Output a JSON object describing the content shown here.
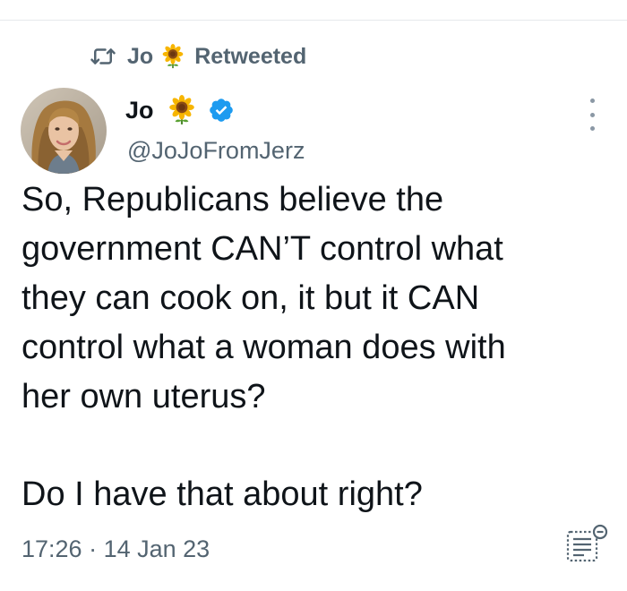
{
  "retweet_header": {
    "icon": "retweet-icon",
    "name": "Jo",
    "emoji_icon": "sunflower-icon",
    "label": "Retweeted"
  },
  "author": {
    "avatar_icon": "profile-photo",
    "name": "Jo",
    "emoji_icon": "sunflower-icon",
    "verified_icon": "verified-badge-icon",
    "handle": "@JoJoFromJerz"
  },
  "tweet": {
    "lines": [
      "So, Republicans believe the",
      "government CAN’T control what",
      "they can cook on, it but it CAN",
      "control what a woman does with",
      "her own uterus?"
    ],
    "paragraph2": "Do I have that about right?"
  },
  "meta": {
    "time": "17:26",
    "separator": " · ",
    "date": "14 Jan 23"
  },
  "actions": {
    "more_icon": "more-vertical-icon",
    "list_icon": "list-view-icon"
  },
  "colors": {
    "text_primary": "#0f1419",
    "text_secondary": "#536471",
    "verified_blue": "#1d9bf0",
    "divider": "#e6e9ec"
  }
}
